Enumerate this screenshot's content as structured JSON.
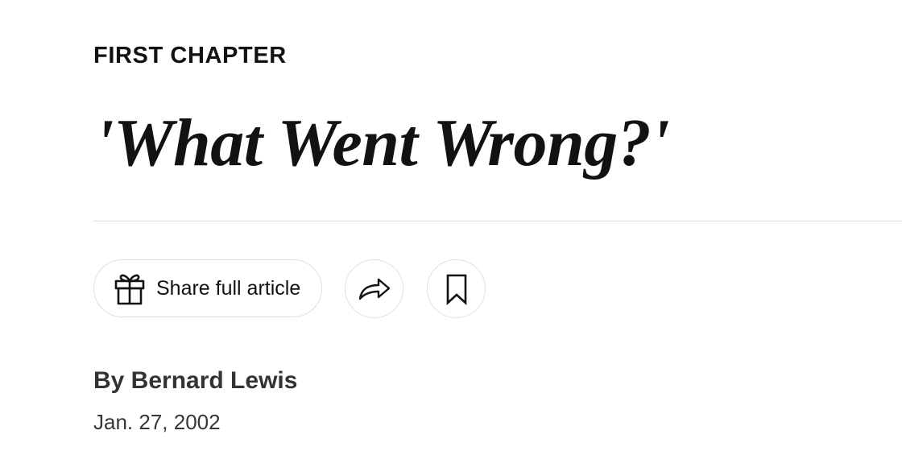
{
  "article": {
    "kicker": "FIRST CHAPTER",
    "headline": "'What Went Wrong?'",
    "byline": "By Bernard Lewis",
    "date": "Jan. 27, 2002"
  },
  "actions": {
    "share_full_label": "Share full article",
    "share_icon": "share-arrow-icon",
    "save_icon": "bookmark-icon",
    "gift_icon": "gift-icon"
  },
  "colors": {
    "text": "#121212",
    "border": "#dfdfdf",
    "byline": "#333333"
  }
}
